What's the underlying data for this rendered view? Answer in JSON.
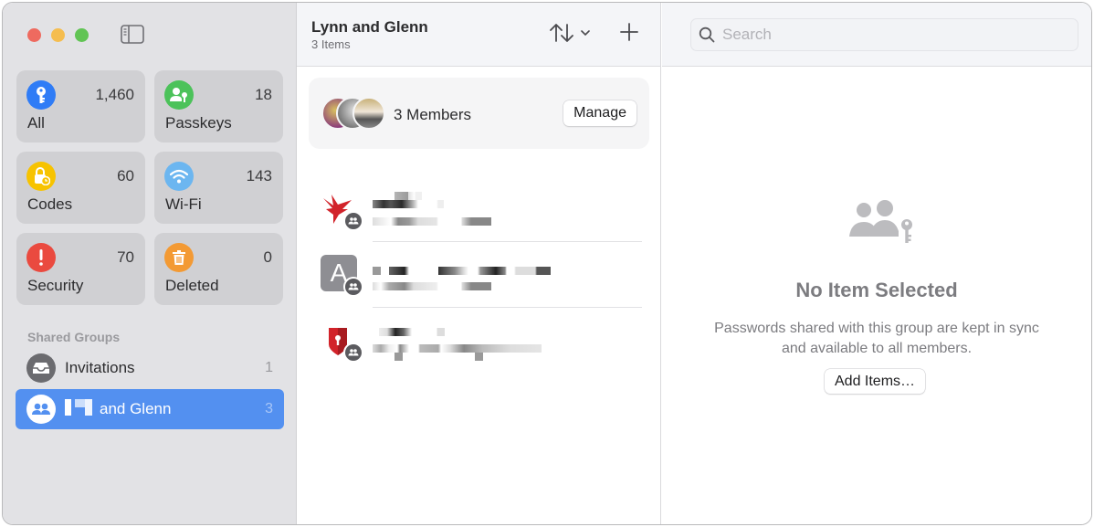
{
  "window": {
    "controls": [
      "close",
      "minimize",
      "zoom"
    ],
    "sidebar_toggle_icon": "sidebar-left-icon"
  },
  "sidebar": {
    "categories": [
      {
        "id": "all",
        "label": "All",
        "count": "1,460",
        "icon": "key-icon",
        "color": "#2f7cf6"
      },
      {
        "id": "passkeys",
        "label": "Passkeys",
        "count": "18",
        "icon": "person-key-icon",
        "color": "#4cc25a"
      },
      {
        "id": "codes",
        "label": "Codes",
        "count": "60",
        "icon": "lock-clock-icon",
        "color": "#f7c300"
      },
      {
        "id": "wifi",
        "label": "Wi-Fi",
        "count": "143",
        "icon": "wifi-icon",
        "color": "#6cb6f0"
      },
      {
        "id": "security",
        "label": "Security",
        "count": "70",
        "icon": "exclamation-icon",
        "color": "#ea4a3f"
      },
      {
        "id": "deleted",
        "label": "Deleted",
        "count": "0",
        "icon": "trash-icon",
        "color": "#f39a34"
      }
    ],
    "section_label": "Shared Groups",
    "groups": [
      {
        "label": "Invitations",
        "count": "1",
        "icon": "inbox-tray-icon",
        "selected": false
      },
      {
        "label": "and Glenn",
        "count": "3",
        "icon": "group-icon",
        "selected": true,
        "redacted_prefix": true
      }
    ]
  },
  "list": {
    "title": "Lynn and Glenn",
    "subtitle": "3 Items",
    "sort_icon": "sort-arrows-icon",
    "add_icon": "plus-icon",
    "members": {
      "label": "3 Members",
      "manage_label": "Manage",
      "avatars": [
        "member-1",
        "member-2",
        "member-3"
      ]
    },
    "items": [
      {
        "icon": "red-bird-logo-icon",
        "shared": true,
        "redacted": true
      },
      {
        "icon": "letter-a-icon",
        "letter": "A",
        "shared": true,
        "redacted": true
      },
      {
        "icon": "red-shield-keyhole-icon",
        "shared": true,
        "redacted": true
      }
    ]
  },
  "detail": {
    "search": {
      "placeholder": "Search",
      "value": ""
    },
    "empty_title": "No Item Selected",
    "empty_desc_line1": "Passwords shared with this group are kept in sync",
    "empty_desc_line2": "and available to all members.",
    "add_items_label": "Add Items…",
    "empty_icon": "people-key-icon"
  }
}
